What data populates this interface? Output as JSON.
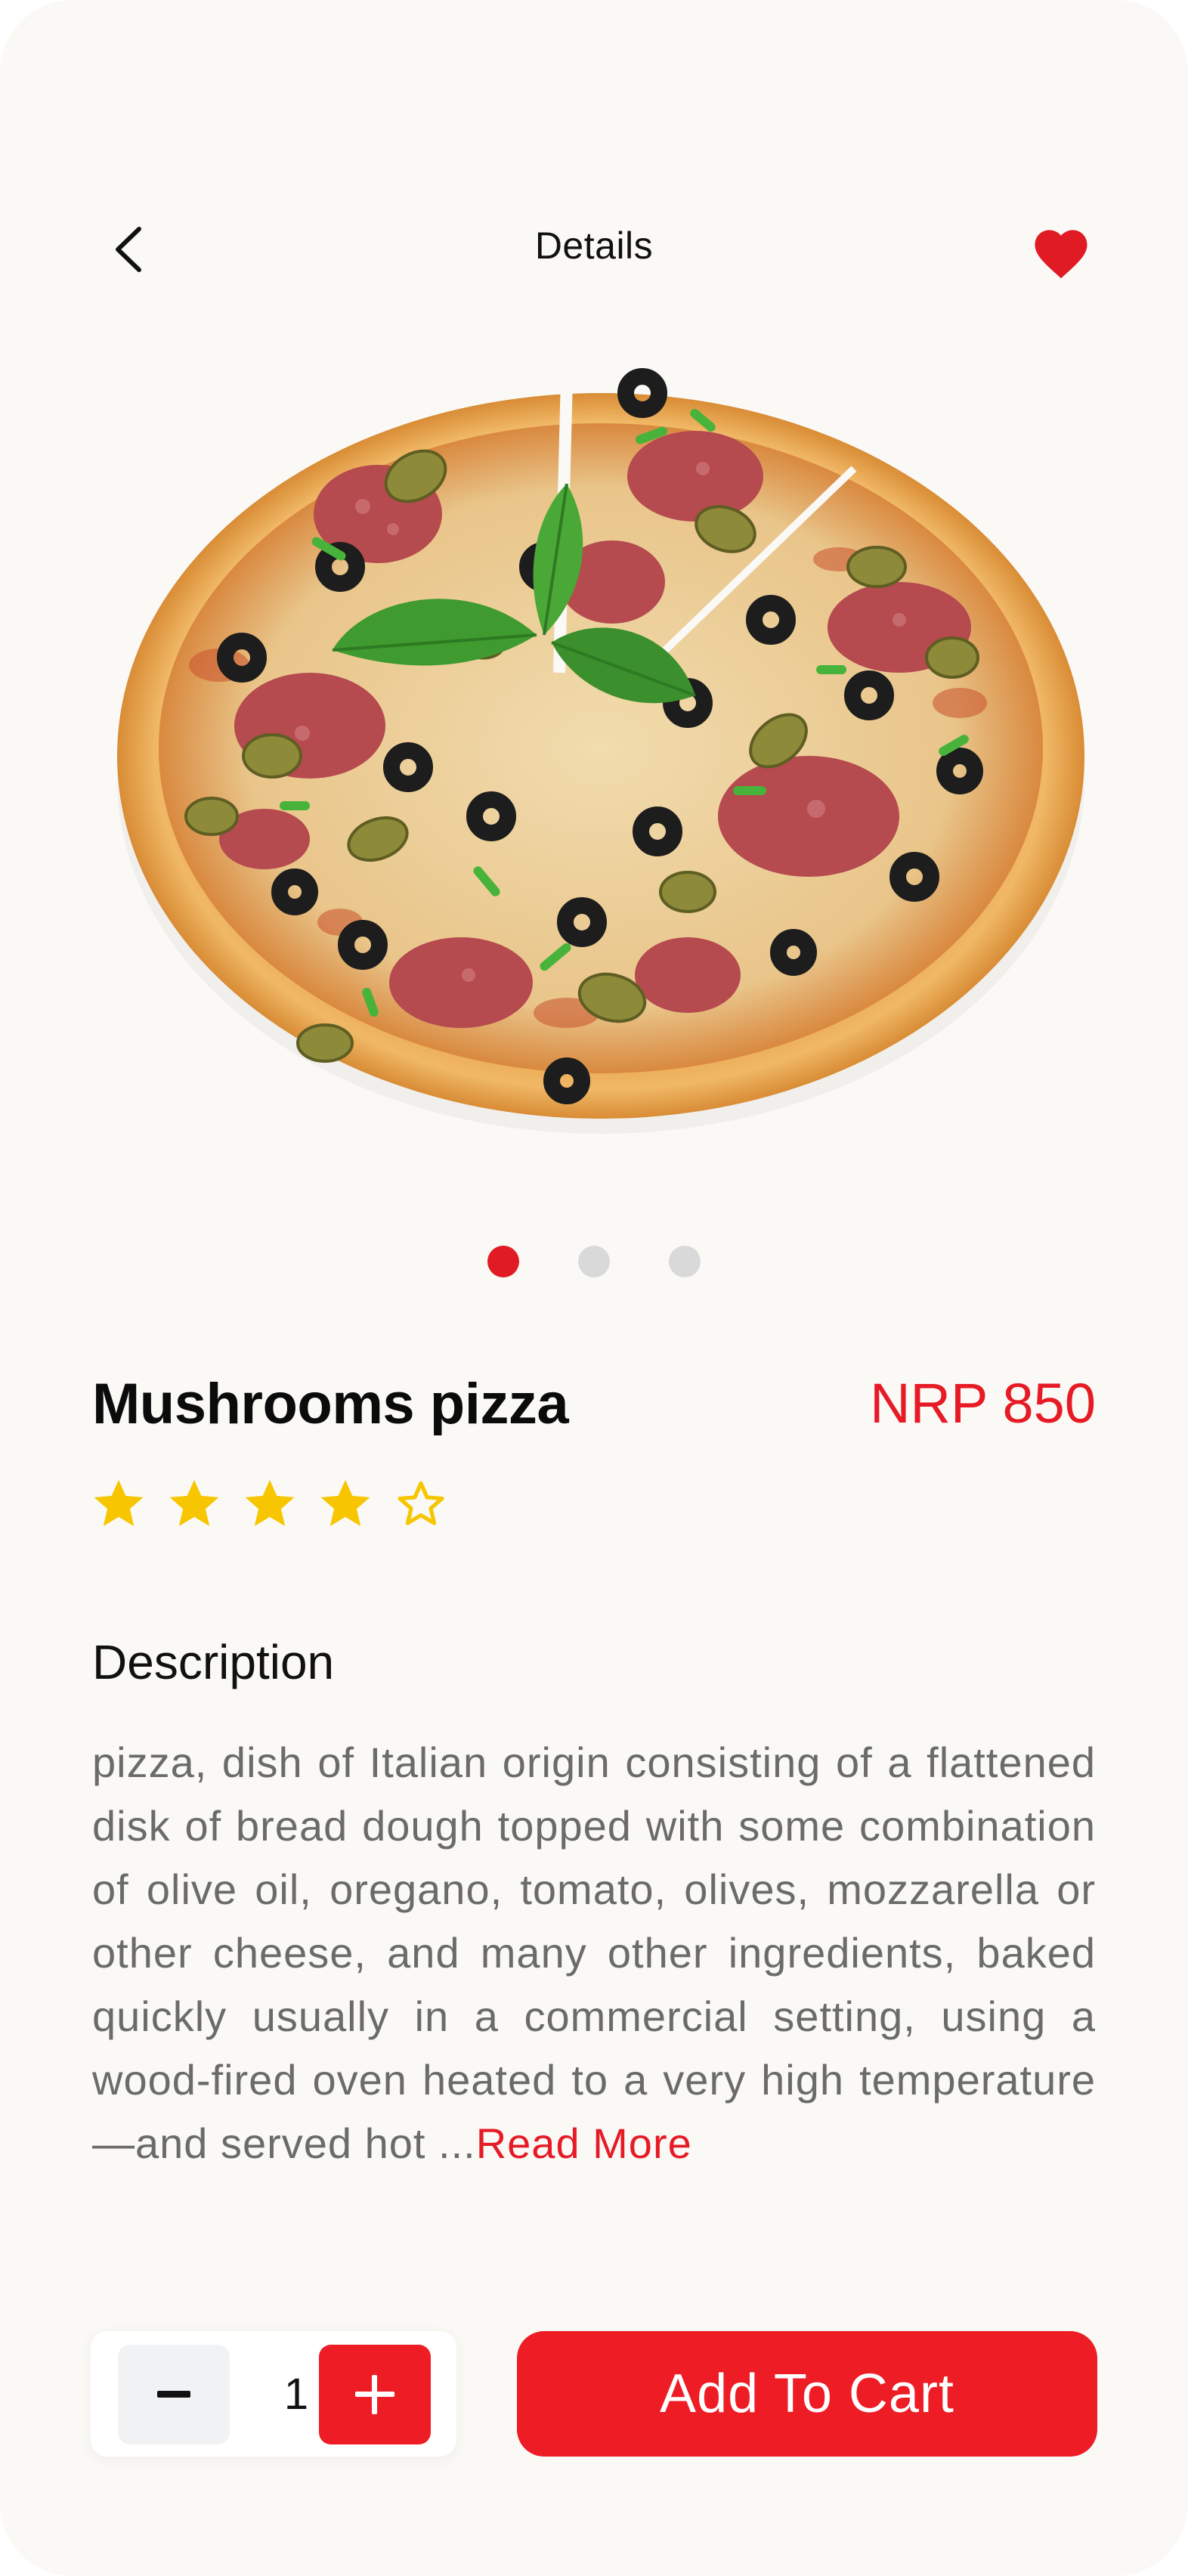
{
  "header": {
    "title": "Details",
    "back_icon": "chevron-left-icon",
    "favorite_icon": "heart-filled-icon",
    "favorite_color": "#e01b24"
  },
  "carousel": {
    "image": "pizza-photo",
    "slides": 3,
    "active_index": 0
  },
  "product": {
    "name": "Mushrooms pizza",
    "price": "NRP 850",
    "rating": 4,
    "rating_max": 5,
    "star_color": "#f7c600"
  },
  "description": {
    "heading": "Description",
    "body": "pizza, dish of Italian origin consisting of a flattened disk of bread dough topped with some combination of olive oil, oregano, tomato, olives, mozzarella or other cheese, and many other ingredients, baked quickly usually in a commercial setting, using a wood-fired oven heated to a very high temperature—and served hot ...",
    "read_more": "Read More"
  },
  "cart": {
    "quantity": "1",
    "minus_icon": "minus-icon",
    "plus_icon": "plus-icon",
    "add_label": "Add To Cart",
    "accent": "#ee1c25"
  }
}
